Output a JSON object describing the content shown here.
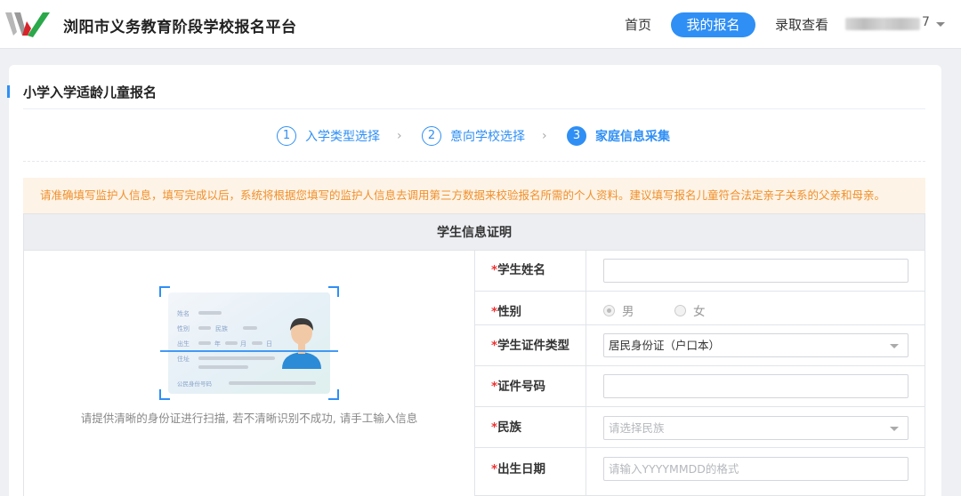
{
  "header": {
    "site_title": "浏阳市义务教育阶段学校报名平台",
    "nav": {
      "home": "首页",
      "my_registration": "我的报名",
      "admission_check": "录取查看"
    },
    "user_suffix": "7"
  },
  "section_title": "小学入学适龄儿童报名",
  "steps": [
    {
      "num": "1",
      "label": "入学类型选择"
    },
    {
      "num": "2",
      "label": "意向学校选择"
    },
    {
      "num": "3",
      "label": "家庭信息采集"
    }
  ],
  "notice": "请准确填写监护人信息，填写完成以后，系统将根据您填写的监护人信息去调用第三方数据来校验报名所需的个人资料。建议填写报名儿童符合法定亲子关系的父亲和母亲。",
  "table_title": "学生信息证明",
  "id_card": {
    "name": "姓名",
    "gender": "性别",
    "ethnicity": "民族",
    "birth": "出生",
    "year": "年",
    "month": "月",
    "day": "日",
    "address": "住址",
    "id_number": "公民身份号码"
  },
  "scan_hint": "请提供清晰的身份证进行扫描, 若不清晰识别不成功, 请手工输入信息",
  "form": {
    "required_mark": "*",
    "name_label": "学生姓名",
    "gender_label": "性别",
    "gender_male": "男",
    "gender_female": "女",
    "id_type_label": "学生证件类型",
    "id_type_value": "居民身份证（户口本）",
    "id_number_label": "证件号码",
    "ethnicity_label": "民族",
    "ethnicity_placeholder": "请选择民族",
    "birth_label": "出生日期",
    "birth_placeholder": "请输入YYYYMMDD的格式"
  },
  "colors": {
    "accent": "#2f8ff5",
    "notice_bg": "#fdf3e6",
    "notice_text": "#f0902c",
    "required": "#ee3333"
  }
}
